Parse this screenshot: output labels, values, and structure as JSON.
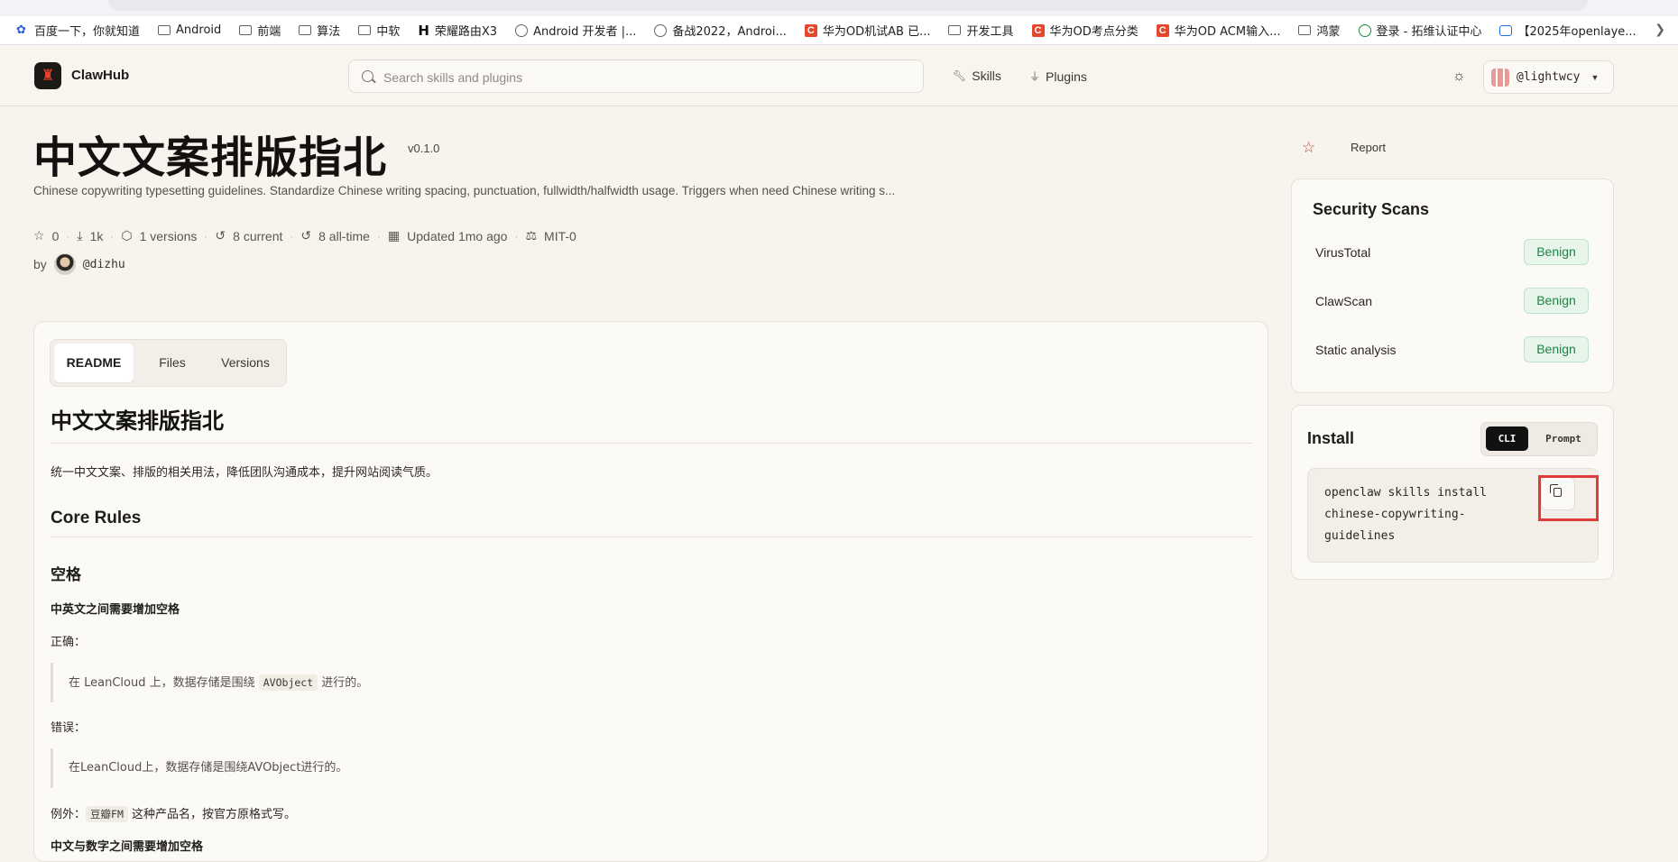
{
  "bookmarks": [
    {
      "label": "百度一下，你就知道",
      "icon": "paw-icon"
    },
    {
      "label": "Android",
      "icon": "folder-icon"
    },
    {
      "label": "前端",
      "icon": "folder-icon"
    },
    {
      "label": "算法",
      "icon": "folder-icon"
    },
    {
      "label": "中软",
      "icon": "folder-icon"
    },
    {
      "label": "荣耀路由X3",
      "icon": "h-icon"
    },
    {
      "label": "Android 开发者 |...",
      "icon": "globe-icon"
    },
    {
      "label": "备战2022，Androi...",
      "icon": "globe-icon"
    },
    {
      "label": "华为OD机试AB 已...",
      "icon": "c-icon"
    },
    {
      "label": "开发工具",
      "icon": "folder-icon"
    },
    {
      "label": "华为OD考点分类",
      "icon": "c-icon"
    },
    {
      "label": "华为OD ACM输入...",
      "icon": "c-icon"
    },
    {
      "label": "鸿蒙",
      "icon": "folder-icon"
    },
    {
      "label": "登录 - 拓维认证中心",
      "icon": "green-circle-icon"
    },
    {
      "label": "【2025年openlaye...",
      "icon": "tv-icon"
    }
  ],
  "header": {
    "brand": "ClawHub",
    "search_placeholder": "Search skills and plugins",
    "nav": {
      "skills": "Skills",
      "plugins": "Plugins"
    },
    "user": "@lightwcy"
  },
  "skill": {
    "title": "中文文案排版指北",
    "version": "v0.1.0",
    "description": "Chinese copywriting typesetting guidelines. Standardize Chinese writing spacing, punctuation, fullwidth/halfwidth usage. Triggers when need Chinese writing s...",
    "stars": "0",
    "downloads": "1k",
    "versions": "1 versions",
    "current": "8 current",
    "all_time": "8 all-time",
    "updated": "Updated 1mo ago",
    "license": "MIT-0",
    "by": "by",
    "author": "@dizhu"
  },
  "actions": {
    "report": "Report"
  },
  "tabs": {
    "readme": "README",
    "files": "Files",
    "versions": "Versions"
  },
  "readme": {
    "h1": "中文文案排版指北",
    "intro": "统一中文文案、排版的相关用法，降低团队沟通成本，提升网站阅读气质。",
    "core_rules": "Core Rules",
    "space_heading": "空格",
    "rule1": "中英文之间需要增加空格",
    "correct_label": "正确：",
    "correct_pre": "在 LeanCloud 上，数据存储是围绕 ",
    "correct_code": "AVObject",
    "correct_post": " 进行的。",
    "wrong_label": "错误：",
    "wrong_example": "在LeanCloud上，数据存储是围绕AVObject进行的。",
    "exception_pre": "例外：",
    "exception_code": "豆瓣FM",
    "exception_post": " 这种产品名，按官方原格式写。",
    "rule2": "中文与数字之间需要增加空格"
  },
  "security": {
    "title": "Security Scans",
    "rows": [
      {
        "label": "VirusTotal",
        "status": "Benign"
      },
      {
        "label": "ClawScan",
        "status": "Benign"
      },
      {
        "label": "Static analysis",
        "status": "Benign"
      }
    ]
  },
  "install": {
    "title": "Install",
    "mode_cli": "CLI",
    "mode_prompt": "Prompt",
    "command": "openclaw skills install\nchinese-copywriting-\nguidelines"
  },
  "colors": {
    "accent": "#d23a2e",
    "benign": "#1e8446",
    "highlight": "#e03b3b"
  }
}
